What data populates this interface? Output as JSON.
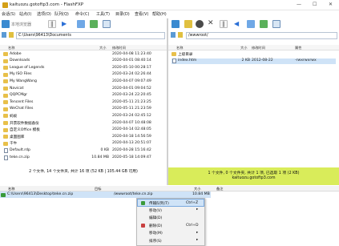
{
  "window": {
    "title": "kaituozu.gotoftp3.com - FlashFXP",
    "min": "—",
    "max": "☐",
    "close": "✕"
  },
  "menu": [
    "会话(S)",
    "站点(I)",
    "选项(O)",
    "队列(Q)",
    "命令(C)",
    "工具(T)",
    "目录(D)",
    "查看(V)",
    "帮助(H)"
  ],
  "left": {
    "connect_label": "本地浏览器",
    "path": "C:\\Users\\96413\\Documents",
    "columns": {
      "name": "名称",
      "size": "大小",
      "modified": "修改时间"
    },
    "files": [
      {
        "name": "Adobe",
        "size": "",
        "date": "2020-04-08 11:23:40",
        "type": "folder"
      },
      {
        "name": "Downloads",
        "size": "",
        "date": "2020-04-01 08:40:14",
        "type": "folder"
      },
      {
        "name": "League of Legends",
        "size": "",
        "date": "2020-05-10 00:28:17",
        "type": "folder"
      },
      {
        "name": "My ISO Files",
        "size": "",
        "date": "2020-03-24 02:26:44",
        "type": "folder"
      },
      {
        "name": "My WangWang",
        "size": "",
        "date": "2020-04-07 09:07:49",
        "type": "folder"
      },
      {
        "name": "Navicat",
        "size": "",
        "date": "2020-04-01 09:04:52",
        "type": "folder"
      },
      {
        "name": "QQPCMgr",
        "size": "",
        "date": "2020-03-24 22:20:45",
        "type": "folder"
      },
      {
        "name": "Tencent Files",
        "size": "",
        "date": "2020-05-11 21:23:25",
        "type": "folder"
      },
      {
        "name": "WeChat Files",
        "size": "",
        "date": "2020-05-11 21:23:59",
        "type": "folder"
      },
      {
        "name": "蚂蚁",
        "size": "",
        "date": "2020-03-24 02:45:12",
        "type": "folder"
      },
      {
        "name": "开票软件数据备份",
        "size": "",
        "date": "2020-04-07 10:48:08",
        "type": "folder"
      },
      {
        "name": "自定义Office 模板",
        "size": "",
        "date": "2020-04-14 02:48:05",
        "type": "folder"
      },
      {
        "name": "桌面图库",
        "size": "",
        "date": "2020-04-18 14:56:59",
        "type": "folder"
      },
      {
        "name": "千牛",
        "size": "",
        "date": "2020-04-13 20:51:07",
        "type": "folder"
      },
      {
        "name": "Default.rdp",
        "size": "0 KB",
        "date": "2020-04-28 15:16:42",
        "type": "file"
      },
      {
        "name": "teke.cn.zip",
        "size": "10.84 MB",
        "date": "2020-05-18 14:09:47",
        "type": "file"
      }
    ],
    "status": "2 个文件, 14 个文件夹, 共计 16 项 (52 KB | 105.44 GB 可用)"
  },
  "right": {
    "path": "/wwwroot/",
    "columns": {
      "name": "名称",
      "size": "大小",
      "modified": "修改时间",
      "attr": "属性"
    },
    "files": [
      {
        "name": "上级目录",
        "size": "",
        "date": "",
        "attr": "",
        "type": "up"
      },
      {
        "name": "index.htm",
        "size": "2 KB",
        "date": "2012-08-22",
        "attr": "-rwxrwxrwx",
        "type": "file"
      }
    ],
    "status": "1 个文件, 0 个文件夹, 共计 1 项, 已选取 1 项 (2 KB)",
    "host": "kaituozu.gotoftp3.com",
    "status_color": "#d9ec5a"
  },
  "queue": {
    "columns": {
      "name": "名称",
      "target": "目标",
      "size": "大小",
      "remark": "备注"
    },
    "item": {
      "name": "C:\\Users\\96413\\Desktop\\teke.cn.zip",
      "target": "/wwwroot/teke.cn.zip",
      "size": "10.84 MB"
    }
  },
  "context_menu": [
    {
      "label": "传输队列(T)",
      "shortcut": "Ctrl+Z",
      "arrow": "",
      "icon_color": "#3a9a3a"
    },
    {
      "label": "移动(V)",
      "shortcut": "",
      "arrow": "▸",
      "icon_color": ""
    },
    {
      "label": "编辑(D)",
      "shortcut": "",
      "arrow": "",
      "icon_color": ""
    },
    {
      "label": "删除(D)",
      "shortcut": "Ctrl+D",
      "arrow": "",
      "icon_color": "#c84040"
    },
    {
      "label": "移动(M)",
      "shortcut": "",
      "arrow": "▸",
      "icon_color": ""
    },
    {
      "label": "排序(S)",
      "shortcut": "",
      "arrow": "▸",
      "icon_color": ""
    }
  ],
  "colors": {
    "accent": "#0a6ad9",
    "selection": "#cfe3f7",
    "folder": "#e8c04a"
  }
}
